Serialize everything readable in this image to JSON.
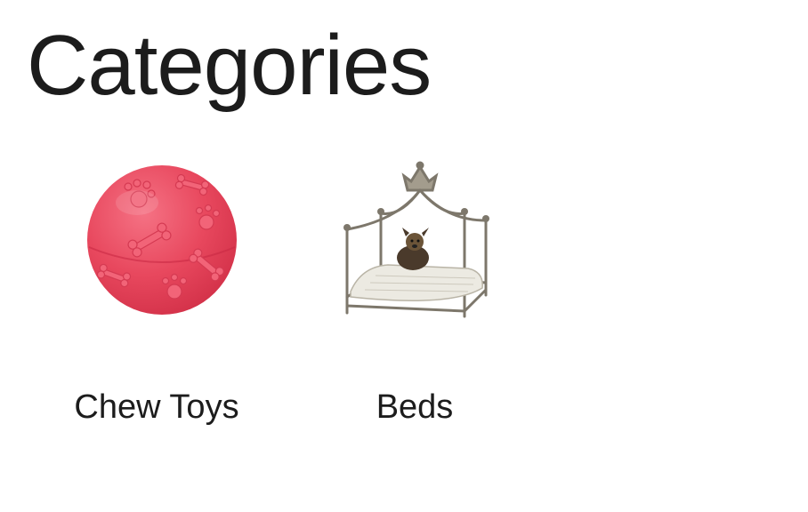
{
  "page": {
    "title": "Categories"
  },
  "categories": [
    {
      "label": "Chew Toys",
      "icon": "chew-toy-ball-icon",
      "color": "#e8485e"
    },
    {
      "label": "Beds",
      "icon": "canopy-dog-bed-icon",
      "color": "#8a8478"
    }
  ]
}
